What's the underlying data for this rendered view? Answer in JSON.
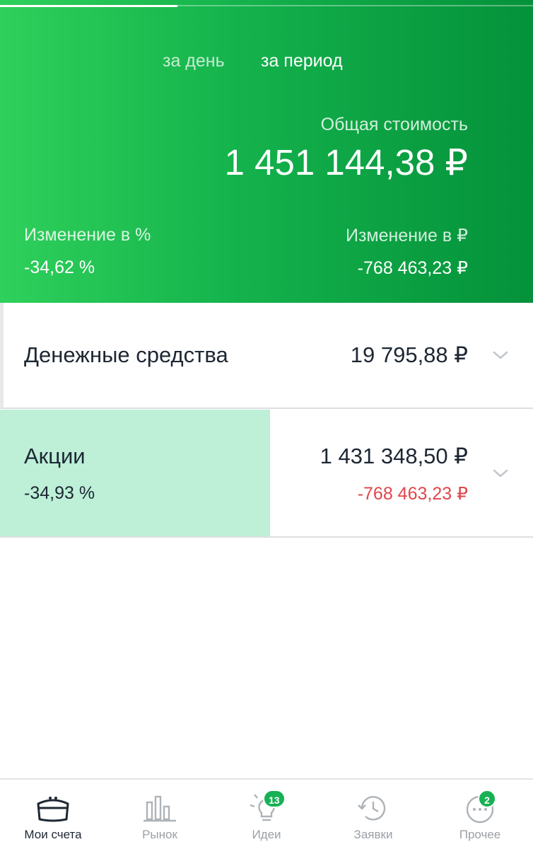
{
  "header": {
    "tabs": [
      {
        "label": "за день",
        "active": false
      },
      {
        "label": "за период",
        "active": true
      }
    ],
    "total_label": "Общая стоимость",
    "total_value": "1 451 144,38 ₽",
    "change_pct_label": "Изменение в  %",
    "change_pct_value": "-34,62  %",
    "change_rub_label": "Изменение в ₽",
    "change_rub_value": "-768 463,23 ₽",
    "progress_fraction": 0.333
  },
  "accounts": {
    "cash": {
      "title": "Денежные средства",
      "amount": "19 795,88 ₽"
    },
    "stocks": {
      "title": "Акции",
      "pct": "-34,93  %",
      "amount": "1 431 348,50 ₽",
      "delta": "-768 463,23 ₽",
      "share_fraction": 0.507
    }
  },
  "nav": {
    "items": [
      {
        "label": "Мои счета",
        "icon": "wallet-icon",
        "active": true
      },
      {
        "label": "Рынок",
        "icon": "chart-bars-icon",
        "active": false
      },
      {
        "label": "Идеи",
        "icon": "lightbulb-icon",
        "active": false,
        "badge": "13"
      },
      {
        "label": "Заявки",
        "icon": "history-clock-icon",
        "active": false
      },
      {
        "label": "Прочее",
        "icon": "more-dots-icon",
        "active": false,
        "badge": "2"
      }
    ]
  },
  "colors": {
    "accent_green": "#17b154",
    "negative_red": "#e0464b",
    "stocks_bar": "#bdf0d7"
  }
}
